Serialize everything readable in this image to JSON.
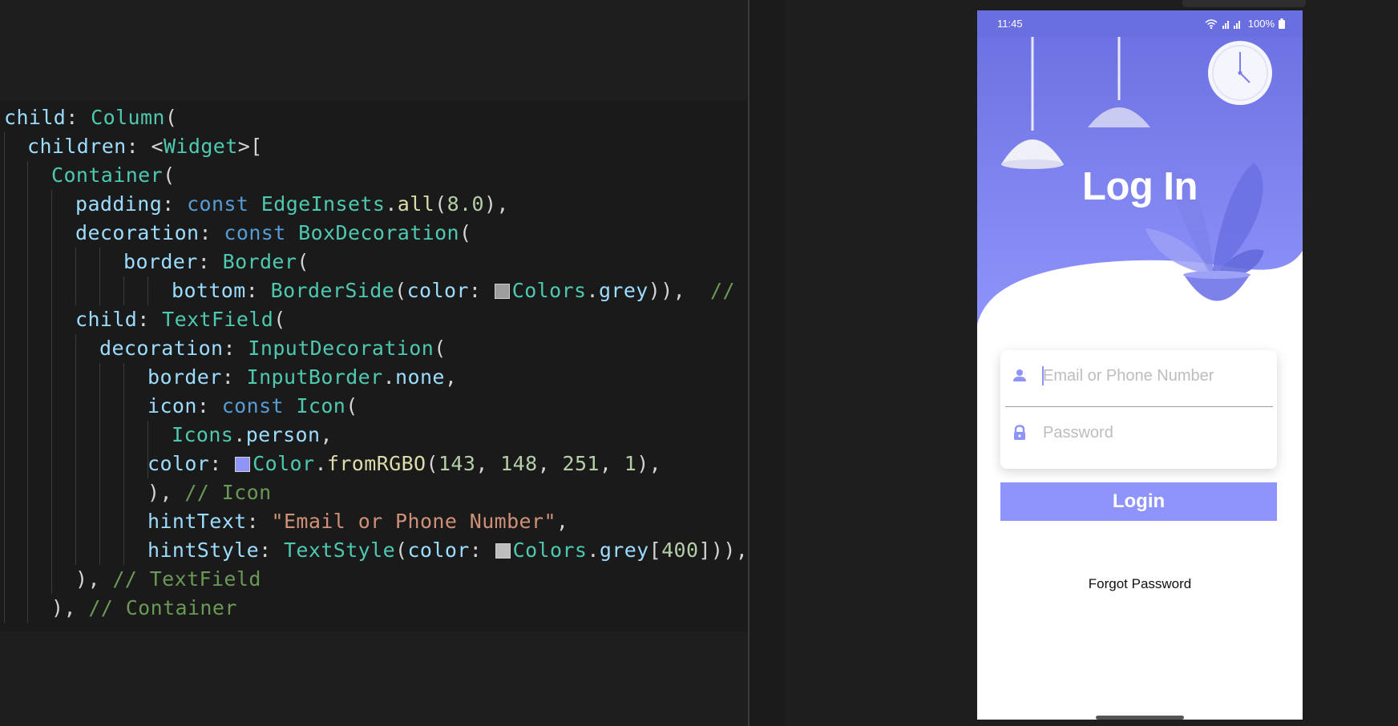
{
  "code": {
    "lines": [
      [
        [
          "prop",
          "child"
        ],
        [
          "punc",
          ": "
        ],
        [
          "class",
          "Column"
        ],
        [
          "punc",
          "("
        ]
      ],
      [
        [
          "prop",
          "children"
        ],
        [
          "punc",
          ": <"
        ],
        [
          "class",
          "Widget"
        ],
        [
          "punc",
          ">["
        ]
      ],
      [
        [
          "class",
          "Container"
        ],
        [
          "punc",
          "("
        ]
      ],
      [
        [
          "prop",
          "padding"
        ],
        [
          "punc",
          ": "
        ],
        [
          "kw",
          "const "
        ],
        [
          "class",
          "EdgeInsets"
        ],
        [
          "punc",
          "."
        ],
        [
          "meth",
          "all"
        ],
        [
          "punc",
          "("
        ],
        [
          "num",
          "8.0"
        ],
        [
          "punc",
          "),"
        ]
      ],
      [
        [
          "prop",
          "decoration"
        ],
        [
          "punc",
          ": "
        ],
        [
          "kw",
          "const "
        ],
        [
          "class",
          "BoxDecoration"
        ],
        [
          "punc",
          "("
        ]
      ],
      [
        [
          "prop",
          "border"
        ],
        [
          "punc",
          ": "
        ],
        [
          "class",
          "Border"
        ],
        [
          "punc",
          "("
        ]
      ],
      [
        [
          "prop",
          "bottom"
        ],
        [
          "punc",
          ": "
        ],
        [
          "class",
          "BorderSide"
        ],
        [
          "punc",
          "("
        ],
        [
          "prop",
          "color"
        ],
        [
          "punc",
          ": "
        ],
        [
          "swatch",
          "#9e9e9e"
        ],
        [
          "class",
          "Colors"
        ],
        [
          "punc",
          "."
        ],
        [
          "prop",
          "grey"
        ],
        [
          "punc",
          ")),  "
        ],
        [
          "com",
          "//"
        ]
      ],
      [
        [
          "prop",
          "child"
        ],
        [
          "punc",
          ": "
        ],
        [
          "class",
          "TextField"
        ],
        [
          "punc",
          "("
        ]
      ],
      [
        [
          "prop",
          "decoration"
        ],
        [
          "punc",
          ": "
        ],
        [
          "class",
          "InputDecoration"
        ],
        [
          "punc",
          "("
        ]
      ],
      [
        [
          "prop",
          "border"
        ],
        [
          "punc",
          ": "
        ],
        [
          "class",
          "InputBorder"
        ],
        [
          "punc",
          "."
        ],
        [
          "prop",
          "none"
        ],
        [
          "punc",
          ","
        ]
      ],
      [
        [
          "prop",
          "icon"
        ],
        [
          "punc",
          ": "
        ],
        [
          "kw",
          "const "
        ],
        [
          "class",
          "Icon"
        ],
        [
          "punc",
          "("
        ]
      ],
      [
        [
          "class",
          "Icons"
        ],
        [
          "punc",
          "."
        ],
        [
          "prop",
          "person"
        ],
        [
          "punc",
          ","
        ]
      ],
      [
        [
          "prop",
          "color"
        ],
        [
          "punc",
          ": "
        ],
        [
          "swatch",
          "#8f94fb"
        ],
        [
          "class",
          "Color"
        ],
        [
          "punc",
          "."
        ],
        [
          "meth",
          "fromRGBO"
        ],
        [
          "punc",
          "("
        ],
        [
          "num",
          "143"
        ],
        [
          "punc",
          ", "
        ],
        [
          "num",
          "148"
        ],
        [
          "punc",
          ", "
        ],
        [
          "num",
          "251"
        ],
        [
          "punc",
          ", "
        ],
        [
          "num",
          "1"
        ],
        [
          "punc",
          "),"
        ]
      ],
      [
        [
          "punc",
          "), "
        ],
        [
          "com",
          "// Icon"
        ]
      ],
      [
        [
          "prop",
          "hintText"
        ],
        [
          "punc",
          ": "
        ],
        [
          "str",
          "\"Email or Phone Number\""
        ],
        [
          "punc",
          ","
        ]
      ],
      [
        [
          "prop",
          "hintStyle"
        ],
        [
          "punc",
          ": "
        ],
        [
          "class",
          "TextStyle"
        ],
        [
          "punc",
          "("
        ],
        [
          "prop",
          "color"
        ],
        [
          "punc",
          ": "
        ],
        [
          "swatch",
          "#bdbdbd"
        ],
        [
          "class",
          "Colors"
        ],
        [
          "punc",
          "."
        ],
        [
          "prop",
          "grey"
        ],
        [
          "punc",
          "["
        ],
        [
          "num",
          "400"
        ],
        [
          "punc",
          "])),"
        ]
      ],
      [
        [
          "punc",
          "), "
        ],
        [
          "com",
          "// TextField"
        ]
      ],
      [
        [
          "punc",
          "), "
        ],
        [
          "com",
          "// Container"
        ]
      ]
    ]
  },
  "phone": {
    "status_time": "11:45",
    "battery_text": "100%",
    "title": "Log In",
    "email_hint": "Email or Phone Number",
    "password_hint": "Password",
    "login_label": "Login",
    "forgot_label": "Forgot Password"
  },
  "colors": {
    "accent": "#8f94fb",
    "hero_top": "#6a6fe0",
    "hero_bottom": "#8f94fb"
  },
  "icons": [
    "person-icon",
    "lock-icon",
    "clock-icon",
    "lamp-icon",
    "plant-icon",
    "wifi-icon",
    "battery-icon"
  ]
}
